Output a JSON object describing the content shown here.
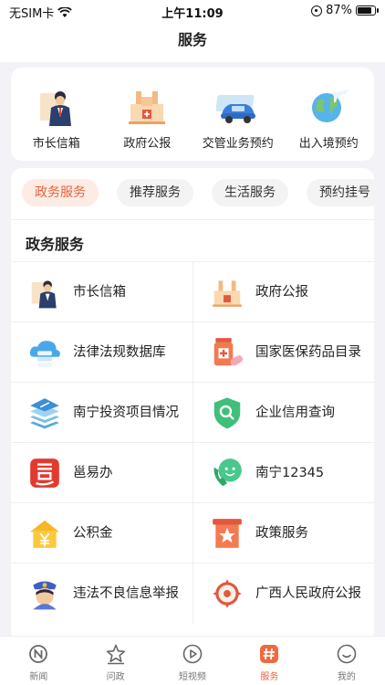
{
  "status": {
    "carrier": "无SIM卡",
    "time": "上午11:09",
    "battery": "87%",
    "battery_level": 0.87
  },
  "header": {
    "title": "服务"
  },
  "quick": [
    {
      "label": "市长信箱",
      "icon": "mayor-mailbox-icon"
    },
    {
      "label": "政府公报",
      "icon": "government-bulletin-icon"
    },
    {
      "label": "交管业务预约",
      "icon": "traffic-car-icon"
    },
    {
      "label": "出入境预约",
      "icon": "globe-plane-icon"
    }
  ],
  "tabs": [
    {
      "label": "政务服务",
      "active": true
    },
    {
      "label": "推荐服务",
      "active": false
    },
    {
      "label": "生活服务",
      "active": false
    },
    {
      "label": "预约挂号",
      "active": false
    }
  ],
  "section_title": "政务服务",
  "services": [
    {
      "label": "市长信箱",
      "icon": "mayor-mailbox-icon"
    },
    {
      "label": "政府公报",
      "icon": "government-bulletin-icon"
    },
    {
      "label": "法律法规数据库",
      "icon": "cloud-database-icon"
    },
    {
      "label": "国家医保药品目录",
      "icon": "medicine-icon"
    },
    {
      "label": "南宁投资项目情况",
      "icon": "layers-icon"
    },
    {
      "label": "企业信用查询",
      "icon": "shield-search-icon"
    },
    {
      "label": "邕易办",
      "icon": "yong-app-icon"
    },
    {
      "label": "南宁12345",
      "icon": "phone-hotline-icon"
    },
    {
      "label": "公积金",
      "icon": "house-yuan-icon"
    },
    {
      "label": "政策服务",
      "icon": "policy-star-icon"
    },
    {
      "label": "违法不良信息举报",
      "icon": "police-report-icon"
    },
    {
      "label": "广西人民政府公报",
      "icon": "gx-emblem-icon"
    }
  ],
  "nav": [
    {
      "label": "新闻",
      "icon": "news-icon",
      "active": false
    },
    {
      "label": "问政",
      "icon": "star-icon",
      "active": false
    },
    {
      "label": "短视频",
      "icon": "play-icon",
      "active": false
    },
    {
      "label": "服务",
      "icon": "service-hash-icon",
      "active": true
    },
    {
      "label": "我的",
      "icon": "smile-icon",
      "active": false
    }
  ],
  "colors": {
    "accent": "#e8643c",
    "tab_active_bg": "#fdebe4",
    "page_bg": "#f3f3f7"
  }
}
